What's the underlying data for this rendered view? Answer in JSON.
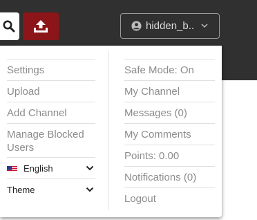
{
  "topbar": {
    "search_icon": "search-icon",
    "upload_icon": "upload-icon",
    "user": {
      "name": "hidden_b..",
      "avatar_icon": "user-circle-icon",
      "chevron_icon": "chevron-down-icon"
    }
  },
  "menu": {
    "left_items": [
      {
        "label": "Settings"
      },
      {
        "label": "Upload"
      },
      {
        "label": "Add Channel"
      },
      {
        "label": "Manage Blocked Users"
      }
    ],
    "language": {
      "label": "English",
      "flag_icon": "us-flag-icon"
    },
    "theme": {
      "label": "Theme"
    },
    "right_items": [
      {
        "label": "Safe Mode: On"
      },
      {
        "label": "My Channel"
      },
      {
        "label": "Messages (0)"
      },
      {
        "label": "My Comments"
      },
      {
        "label": "Points: 0.00"
      },
      {
        "label": "Notifications (0)"
      },
      {
        "label": "Logout"
      }
    ]
  },
  "colors": {
    "topbar_bg": "#303030",
    "upload_red": "#8b1518",
    "menu_text": "#8c8c8c"
  }
}
